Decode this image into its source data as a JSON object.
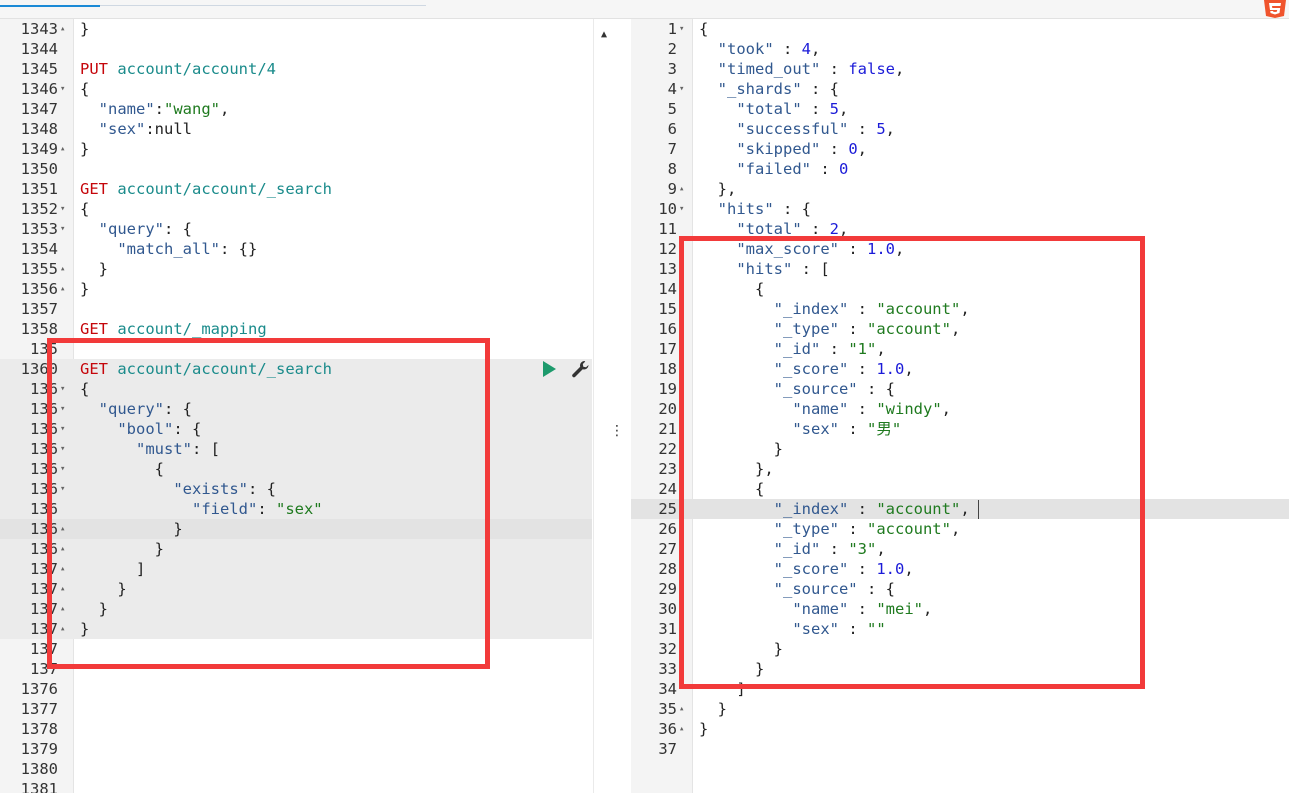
{
  "left_editor": {
    "lines": [
      {
        "n": "1343",
        "fold": "up",
        "code": [
          {
            "t": "}",
            "c": "p"
          }
        ]
      },
      {
        "n": "1344",
        "code": []
      },
      {
        "n": "1345",
        "code": [
          {
            "t": "PUT",
            "c": "m"
          },
          {
            "t": " ",
            "c": "p"
          },
          {
            "t": "account/account/4",
            "c": "u"
          }
        ]
      },
      {
        "n": "1346",
        "fold": "down",
        "code": [
          {
            "t": "{",
            "c": "p"
          }
        ]
      },
      {
        "n": "1347",
        "code": [
          {
            "t": "  ",
            "c": "p"
          },
          {
            "t": "\"name\"",
            "c": "s"
          },
          {
            "t": ":",
            "c": "p"
          },
          {
            "t": "\"wang\"",
            "c": "v"
          },
          {
            "t": ",",
            "c": "p"
          }
        ]
      },
      {
        "n": "1348",
        "code": [
          {
            "t": "  ",
            "c": "p"
          },
          {
            "t": "\"sex\"",
            "c": "s"
          },
          {
            "t": ":null",
            "c": "p"
          }
        ]
      },
      {
        "n": "1349",
        "fold": "up",
        "code": [
          {
            "t": "}",
            "c": "p"
          }
        ]
      },
      {
        "n": "1350",
        "code": []
      },
      {
        "n": "1351",
        "code": [
          {
            "t": "GET",
            "c": "m"
          },
          {
            "t": " ",
            "c": "p"
          },
          {
            "t": "account/account/_search",
            "c": "u"
          }
        ]
      },
      {
        "n": "1352",
        "fold": "down",
        "code": [
          {
            "t": "{",
            "c": "p"
          }
        ]
      },
      {
        "n": "1353",
        "fold": "down",
        "code": [
          {
            "t": "  ",
            "c": "p"
          },
          {
            "t": "\"query\"",
            "c": "s"
          },
          {
            "t": ": {",
            "c": "p"
          }
        ]
      },
      {
        "n": "1354",
        "code": [
          {
            "t": "    ",
            "c": "p"
          },
          {
            "t": "\"match_all\"",
            "c": "s"
          },
          {
            "t": ": {}",
            "c": "p"
          }
        ]
      },
      {
        "n": "1355",
        "fold": "up",
        "code": [
          {
            "t": "  }",
            "c": "p"
          }
        ]
      },
      {
        "n": "1356",
        "fold": "up",
        "code": [
          {
            "t": "}",
            "c": "p"
          }
        ]
      },
      {
        "n": "1357",
        "code": []
      },
      {
        "n": "1358",
        "code": [
          {
            "t": "GET",
            "c": "m"
          },
          {
            "t": " ",
            "c": "p"
          },
          {
            "t": "account/_mapping",
            "c": "u"
          }
        ]
      },
      {
        "n": "135",
        "code": []
      },
      {
        "n": "1360",
        "hl": true,
        "code": [
          {
            "t": "GET",
            "c": "m"
          },
          {
            "t": " ",
            "c": "p"
          },
          {
            "t": "account/account/_search",
            "c": "u"
          }
        ]
      },
      {
        "n": "136",
        "fold": "down",
        "hl": true,
        "code": [
          {
            "t": "{",
            "c": "p"
          }
        ]
      },
      {
        "n": "136",
        "fold": "down",
        "hl": true,
        "code": [
          {
            "t": "  ",
            "c": "p"
          },
          {
            "t": "\"query\"",
            "c": "s"
          },
          {
            "t": ": {",
            "c": "p"
          }
        ]
      },
      {
        "n": "136",
        "fold": "down",
        "hl": true,
        "code": [
          {
            "t": "    ",
            "c": "p"
          },
          {
            "t": "\"bool\"",
            "c": "s"
          },
          {
            "t": ": {",
            "c": "p"
          }
        ]
      },
      {
        "n": "136",
        "fold": "down",
        "hl": true,
        "code": [
          {
            "t": "      ",
            "c": "p"
          },
          {
            "t": "\"must\"",
            "c": "s"
          },
          {
            "t": ": [",
            "c": "p"
          }
        ]
      },
      {
        "n": "136",
        "fold": "down",
        "hl": true,
        "code": [
          {
            "t": "        {",
            "c": "p"
          }
        ]
      },
      {
        "n": "136",
        "fold": "down",
        "hl": true,
        "code": [
          {
            "t": "          ",
            "c": "p"
          },
          {
            "t": "\"exists\"",
            "c": "s"
          },
          {
            "t": ": {",
            "c": "p"
          }
        ]
      },
      {
        "n": "136",
        "hl": true,
        "code": [
          {
            "t": "            ",
            "c": "p"
          },
          {
            "t": "\"field\"",
            "c": "s"
          },
          {
            "t": ": ",
            "c": "p"
          },
          {
            "t": "\"sex\"",
            "c": "v"
          }
        ]
      },
      {
        "n": "136",
        "fold": "up",
        "active": true,
        "code": [
          {
            "t": "          }",
            "c": "p"
          }
        ]
      },
      {
        "n": "136",
        "fold": "up",
        "hl": true,
        "code": [
          {
            "t": "        }",
            "c": "p"
          }
        ]
      },
      {
        "n": "137",
        "fold": "up",
        "hl": true,
        "code": [
          {
            "t": "      ]",
            "c": "p"
          }
        ]
      },
      {
        "n": "137",
        "fold": "up",
        "hl": true,
        "code": [
          {
            "t": "    }",
            "c": "p"
          }
        ]
      },
      {
        "n": "137",
        "fold": "up",
        "hl": true,
        "code": [
          {
            "t": "  }",
            "c": "p"
          }
        ]
      },
      {
        "n": "137",
        "fold": "up",
        "hl": true,
        "code": [
          {
            "t": "}",
            "c": "p"
          }
        ]
      },
      {
        "n": "137",
        "code": []
      },
      {
        "n": "137",
        "code": []
      },
      {
        "n": "1376",
        "code": []
      },
      {
        "n": "1377",
        "code": []
      },
      {
        "n": "1378",
        "code": []
      },
      {
        "n": "1379",
        "code": []
      },
      {
        "n": "1380",
        "code": []
      },
      {
        "n": "1381",
        "code": []
      }
    ]
  },
  "right_editor": {
    "lines": [
      {
        "n": "1",
        "fold": "down",
        "code": [
          {
            "t": "{",
            "c": "p"
          }
        ]
      },
      {
        "n": "2",
        "code": [
          {
            "t": "  ",
            "c": "p"
          },
          {
            "t": "\"took\"",
            "c": "s"
          },
          {
            "t": " : ",
            "c": "p"
          },
          {
            "t": "4",
            "c": "n"
          },
          {
            "t": ",",
            "c": "p"
          }
        ]
      },
      {
        "n": "3",
        "code": [
          {
            "t": "  ",
            "c": "p"
          },
          {
            "t": "\"timed_out\"",
            "c": "s"
          },
          {
            "t": " : ",
            "c": "p"
          },
          {
            "t": "false",
            "c": "n"
          },
          {
            "t": ",",
            "c": "p"
          }
        ]
      },
      {
        "n": "4",
        "fold": "down",
        "code": [
          {
            "t": "  ",
            "c": "p"
          },
          {
            "t": "\"_shards\"",
            "c": "s"
          },
          {
            "t": " : {",
            "c": "p"
          }
        ]
      },
      {
        "n": "5",
        "code": [
          {
            "t": "    ",
            "c": "p"
          },
          {
            "t": "\"total\"",
            "c": "s"
          },
          {
            "t": " : ",
            "c": "p"
          },
          {
            "t": "5",
            "c": "n"
          },
          {
            "t": ",",
            "c": "p"
          }
        ]
      },
      {
        "n": "6",
        "code": [
          {
            "t": "    ",
            "c": "p"
          },
          {
            "t": "\"successful\"",
            "c": "s"
          },
          {
            "t": " : ",
            "c": "p"
          },
          {
            "t": "5",
            "c": "n"
          },
          {
            "t": ",",
            "c": "p"
          }
        ]
      },
      {
        "n": "7",
        "code": [
          {
            "t": "    ",
            "c": "p"
          },
          {
            "t": "\"skipped\"",
            "c": "s"
          },
          {
            "t": " : ",
            "c": "p"
          },
          {
            "t": "0",
            "c": "n"
          },
          {
            "t": ",",
            "c": "p"
          }
        ]
      },
      {
        "n": "8",
        "code": [
          {
            "t": "    ",
            "c": "p"
          },
          {
            "t": "\"failed\"",
            "c": "s"
          },
          {
            "t": " : ",
            "c": "p"
          },
          {
            "t": "0",
            "c": "n"
          }
        ]
      },
      {
        "n": "9",
        "fold": "up",
        "code": [
          {
            "t": "  },",
            "c": "p"
          }
        ]
      },
      {
        "n": "10",
        "fold": "down",
        "code": [
          {
            "t": "  ",
            "c": "p"
          },
          {
            "t": "\"hits\"",
            "c": "s"
          },
          {
            "t": " : {",
            "c": "p"
          }
        ]
      },
      {
        "n": "11",
        "code": [
          {
            "t": "    ",
            "c": "p"
          },
          {
            "t": "\"total\"",
            "c": "s"
          },
          {
            "t": " : ",
            "c": "p"
          },
          {
            "t": "2",
            "c": "n"
          },
          {
            "t": ",",
            "c": "p"
          }
        ]
      },
      {
        "n": "12",
        "code": [
          {
            "t": "    ",
            "c": "p"
          },
          {
            "t": "\"max_score\"",
            "c": "s"
          },
          {
            "t": " : ",
            "c": "p"
          },
          {
            "t": "1.0",
            "c": "n"
          },
          {
            "t": ",",
            "c": "p"
          }
        ]
      },
      {
        "n": "13",
        "fold": "down",
        "code": [
          {
            "t": "    ",
            "c": "p"
          },
          {
            "t": "\"hits\"",
            "c": "s"
          },
          {
            "t": " : [",
            "c": "p"
          }
        ]
      },
      {
        "n": "14",
        "fold": "down",
        "code": [
          {
            "t": "      {",
            "c": "p"
          }
        ]
      },
      {
        "n": "15",
        "code": [
          {
            "t": "        ",
            "c": "p"
          },
          {
            "t": "\"_index\"",
            "c": "s"
          },
          {
            "t": " : ",
            "c": "p"
          },
          {
            "t": "\"account\"",
            "c": "v"
          },
          {
            "t": ",",
            "c": "p"
          }
        ]
      },
      {
        "n": "16",
        "code": [
          {
            "t": "        ",
            "c": "p"
          },
          {
            "t": "\"_type\"",
            "c": "s"
          },
          {
            "t": " : ",
            "c": "p"
          },
          {
            "t": "\"account\"",
            "c": "v"
          },
          {
            "t": ",",
            "c": "p"
          }
        ]
      },
      {
        "n": "17",
        "code": [
          {
            "t": "        ",
            "c": "p"
          },
          {
            "t": "\"_id\"",
            "c": "s"
          },
          {
            "t": " : ",
            "c": "p"
          },
          {
            "t": "\"1\"",
            "c": "v"
          },
          {
            "t": ",",
            "c": "p"
          }
        ]
      },
      {
        "n": "18",
        "code": [
          {
            "t": "        ",
            "c": "p"
          },
          {
            "t": "\"_score\"",
            "c": "s"
          },
          {
            "t": " : ",
            "c": "p"
          },
          {
            "t": "1.0",
            "c": "n"
          },
          {
            "t": ",",
            "c": "p"
          }
        ]
      },
      {
        "n": "19",
        "fold": "down",
        "code": [
          {
            "t": "        ",
            "c": "p"
          },
          {
            "t": "\"_source\"",
            "c": "s"
          },
          {
            "t": " : {",
            "c": "p"
          }
        ]
      },
      {
        "n": "20",
        "code": [
          {
            "t": "          ",
            "c": "p"
          },
          {
            "t": "\"name\"",
            "c": "s"
          },
          {
            "t": " : ",
            "c": "p"
          },
          {
            "t": "\"windy\"",
            "c": "v"
          },
          {
            "t": ",",
            "c": "p"
          }
        ]
      },
      {
        "n": "21",
        "code": [
          {
            "t": "          ",
            "c": "p"
          },
          {
            "t": "\"sex\"",
            "c": "s"
          },
          {
            "t": " : ",
            "c": "p"
          },
          {
            "t": "\"男\"",
            "c": "v"
          }
        ]
      },
      {
        "n": "22",
        "fold": "up",
        "code": [
          {
            "t": "        }",
            "c": "p"
          }
        ]
      },
      {
        "n": "23",
        "fold": "up",
        "code": [
          {
            "t": "      },",
            "c": "p"
          }
        ]
      },
      {
        "n": "24",
        "fold": "down",
        "code": [
          {
            "t": "      {",
            "c": "p"
          }
        ]
      },
      {
        "n": "25",
        "active": true,
        "code": [
          {
            "t": "        ",
            "c": "p"
          },
          {
            "t": "\"_index\"",
            "c": "s"
          },
          {
            "t": " : ",
            "c": "p"
          },
          {
            "t": "\"account\"",
            "c": "v"
          },
          {
            "t": ",",
            "c": "p"
          }
        ]
      },
      {
        "n": "26",
        "code": [
          {
            "t": "        ",
            "c": "p"
          },
          {
            "t": "\"_type\"",
            "c": "s"
          },
          {
            "t": " : ",
            "c": "p"
          },
          {
            "t": "\"account\"",
            "c": "v"
          },
          {
            "t": ",",
            "c": "p"
          }
        ]
      },
      {
        "n": "27",
        "code": [
          {
            "t": "        ",
            "c": "p"
          },
          {
            "t": "\"_id\"",
            "c": "s"
          },
          {
            "t": " : ",
            "c": "p"
          },
          {
            "t": "\"3\"",
            "c": "v"
          },
          {
            "t": ",",
            "c": "p"
          }
        ]
      },
      {
        "n": "28",
        "code": [
          {
            "t": "        ",
            "c": "p"
          },
          {
            "t": "\"_score\"",
            "c": "s"
          },
          {
            "t": " : ",
            "c": "p"
          },
          {
            "t": "1.0",
            "c": "n"
          },
          {
            "t": ",",
            "c": "p"
          }
        ]
      },
      {
        "n": "29",
        "fold": "down",
        "code": [
          {
            "t": "        ",
            "c": "p"
          },
          {
            "t": "\"_source\"",
            "c": "s"
          },
          {
            "t": " : {",
            "c": "p"
          }
        ]
      },
      {
        "n": "30",
        "code": [
          {
            "t": "          ",
            "c": "p"
          },
          {
            "t": "\"name\"",
            "c": "s"
          },
          {
            "t": " : ",
            "c": "p"
          },
          {
            "t": "\"mei\"",
            "c": "v"
          },
          {
            "t": ",",
            "c": "p"
          }
        ]
      },
      {
        "n": "31",
        "code": [
          {
            "t": "          ",
            "c": "p"
          },
          {
            "t": "\"sex\"",
            "c": "s"
          },
          {
            "t": " : ",
            "c": "p"
          },
          {
            "t": "\"\"",
            "c": "v"
          }
        ]
      },
      {
        "n": "32",
        "fold": "up",
        "code": [
          {
            "t": "        }",
            "c": "p"
          }
        ]
      },
      {
        "n": "33",
        "fold": "up",
        "code": [
          {
            "t": "      }",
            "c": "p"
          }
        ]
      },
      {
        "n": "34",
        "code": [
          {
            "t": "    ]",
            "c": "p"
          }
        ]
      },
      {
        "n": "35",
        "fold": "up",
        "code": [
          {
            "t": "  }",
            "c": "p"
          }
        ]
      },
      {
        "n": "36",
        "fold": "up",
        "code": [
          {
            "t": "}",
            "c": "p"
          }
        ]
      },
      {
        "n": "37",
        "code": []
      }
    ]
  },
  "icons": {
    "send": "play-icon",
    "settings": "wrench-icon",
    "pane_menu": "vertical-dots-icon",
    "scroll_up": "triangle-up-icon",
    "logo": "html5-logo-icon"
  },
  "glyphs": {
    "fold_down": "▾",
    "fold_up": "▴",
    "scroll_up": "▲",
    "dots": "⋮"
  },
  "colors": {
    "method": "#c5060b",
    "url": "#1a8b8b",
    "key": "#31588f",
    "string": "#1f7a1f",
    "number": "#1b1bd8",
    "send_button": "#1d9a6c",
    "annotation_box": "#f23a3a"
  }
}
